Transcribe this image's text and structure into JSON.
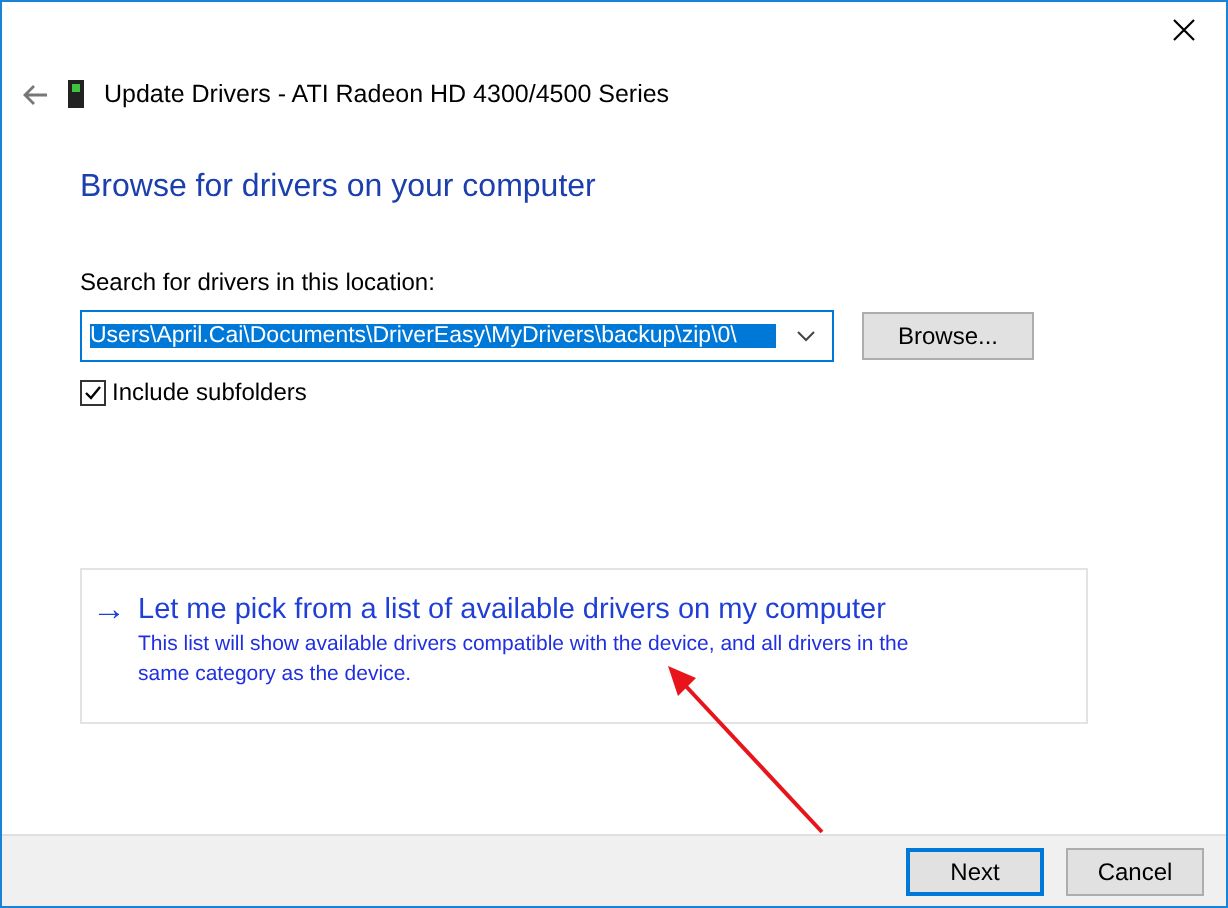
{
  "window": {
    "title": "Update Drivers - ATI Radeon HD 4300/4500 Series"
  },
  "heading": "Browse for drivers on your computer",
  "location": {
    "label": "Search for drivers in this location:",
    "value": "Users\\April.Cai\\Documents\\DriverEasy\\MyDrivers\\backup\\zip\\0\\",
    "selected": true,
    "browse": "Browse..."
  },
  "include_subfolders": {
    "label": "Include subfolders",
    "checked": true
  },
  "option": {
    "arrow": "→",
    "title": "Let me pick from a list of available drivers on my computer",
    "description": "This list will show available drivers compatible with the device, and all drivers in the same category as the device."
  },
  "buttons": [
    {
      "label": "Next",
      "default": true
    },
    {
      "label": "Cancel",
      "default": false
    }
  ]
}
